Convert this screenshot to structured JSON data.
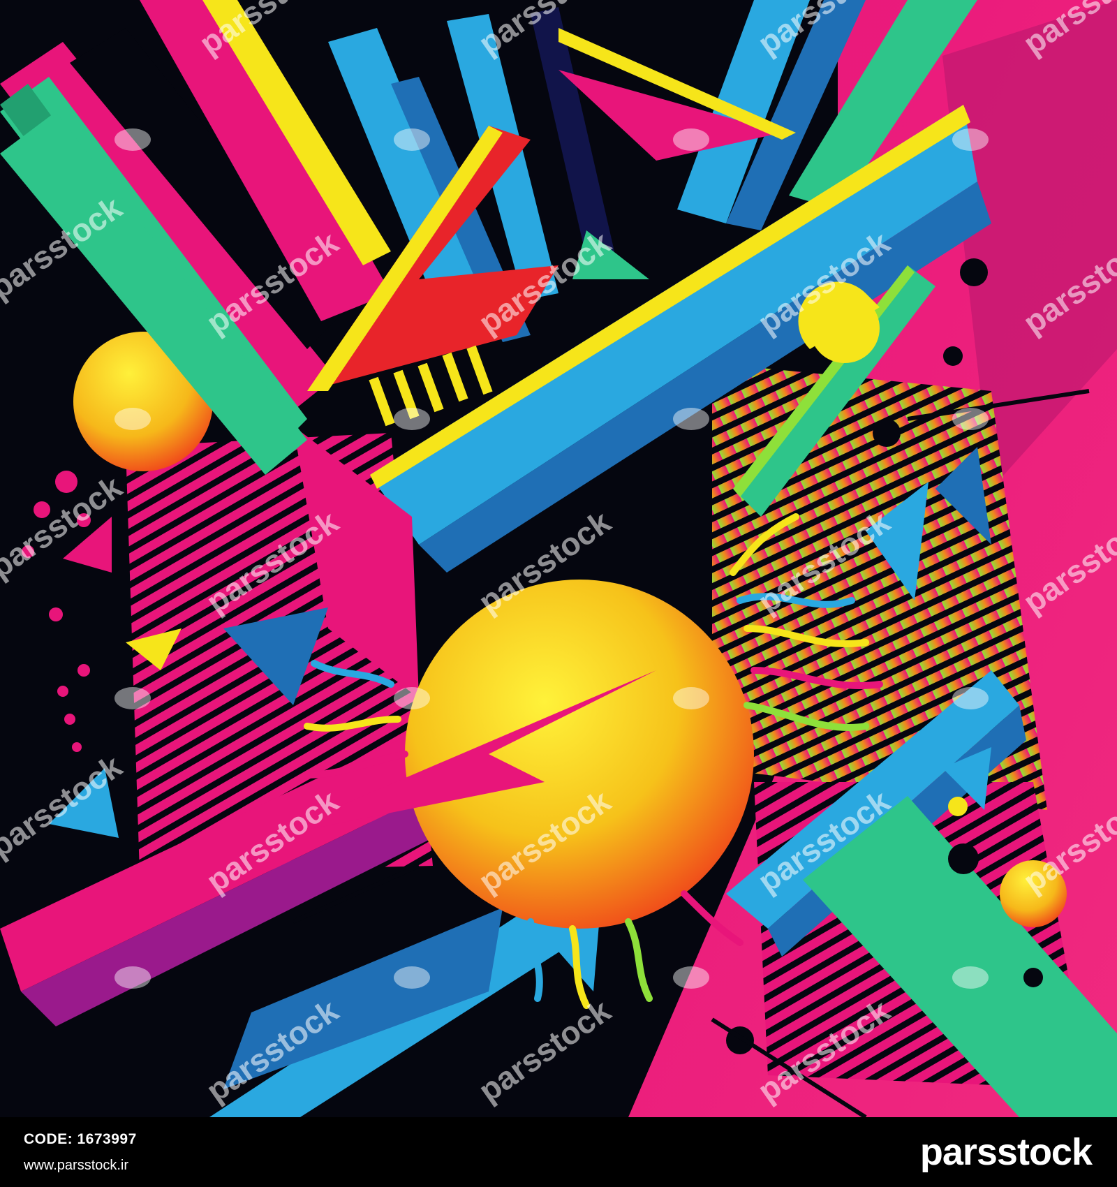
{
  "artwork": {
    "description_colors": {
      "background": "#05060f",
      "magenta": "#e8157a",
      "pink": "#f0297f",
      "cyan": "#2aa8e0",
      "blue": "#1f6fb5",
      "navy": "#11144a",
      "yellow": "#f6e51a",
      "orange": "#f08a1a",
      "red": "#e8242a",
      "green": "#2ec58a",
      "lime": "#8ee03a"
    },
    "watermark_text": "parsstock"
  },
  "footer": {
    "code_label": "CODE: 1673997",
    "url": "www.parsstock.ir",
    "brand": "parsstock"
  }
}
